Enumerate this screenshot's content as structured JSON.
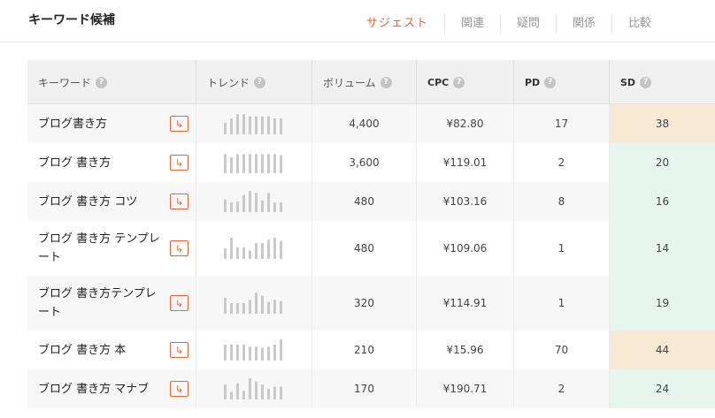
{
  "header": {
    "title": "キーワード候補",
    "tabs": [
      {
        "label": "サジェスト",
        "active": true
      },
      {
        "label": "関連",
        "active": false
      },
      {
        "label": "疑問",
        "active": false
      },
      {
        "label": "関係",
        "active": false
      },
      {
        "label": "比較",
        "active": false
      }
    ]
  },
  "table": {
    "columns": {
      "keyword": "キーワード",
      "trend": "トレンド",
      "volume": "ボリューム",
      "cpc": "CPC",
      "pd": "PD",
      "sd": "SD"
    },
    "help_icon": "?",
    "link_icon": "↳",
    "rows": [
      {
        "keyword": "ブログ書き方",
        "volume": "4,400",
        "cpc": "¥82.80",
        "pd": "17",
        "sd": "38",
        "sd_level": "medium",
        "trend": [
          0.55,
          0.75,
          0.95,
          0.95,
          0.85,
          0.85,
          0.85,
          0.85,
          0.75,
          0.75
        ]
      },
      {
        "keyword": "ブログ 書き方",
        "volume": "3,600",
        "cpc": "¥119.01",
        "pd": "2",
        "sd": "20",
        "sd_level": "low",
        "trend": [
          0.9,
          0.75,
          0.9,
          0.9,
          0.9,
          0.9,
          0.9,
          0.9,
          0.9,
          0.85
        ]
      },
      {
        "keyword": "ブログ 書き方 コツ",
        "volume": "480",
        "cpc": "¥103.16",
        "pd": "8",
        "sd": "16",
        "sd_level": "low",
        "trend": [
          0.6,
          0.45,
          0.5,
          0.8,
          1.0,
          0.9,
          0.55,
          0.9,
          0.45,
          0.45
        ]
      },
      {
        "keyword": "ブログ 書き方 テンプレート",
        "volume": "480",
        "cpc": "¥109.06",
        "pd": "1",
        "sd": "14",
        "sd_level": "low",
        "trend": [
          0.5,
          1.0,
          0.55,
          0.55,
          0.4,
          0.75,
          0.75,
          0.9,
          1.0,
          0.85
        ]
      },
      {
        "keyword": "ブログ 書き方テンプレート",
        "volume": "320",
        "cpc": "¥114.91",
        "pd": "1",
        "sd": "19",
        "sd_level": "low",
        "trend": [
          0.75,
          0.5,
          0.5,
          0.5,
          0.65,
          1.0,
          0.85,
          0.55,
          0.65,
          0.6
        ]
      },
      {
        "keyword": "ブログ 書き方 本",
        "volume": "210",
        "cpc": "¥15.96",
        "pd": "70",
        "sd": "44",
        "sd_level": "medium",
        "trend": [
          0.75,
          0.75,
          0.75,
          0.75,
          0.65,
          0.65,
          0.6,
          0.65,
          0.75,
          1.0
        ]
      },
      {
        "keyword": "ブログ 書き方 マナブ",
        "volume": "170",
        "cpc": "¥190.71",
        "pd": "2",
        "sd": "24",
        "sd_level": "low",
        "trend": [
          0.7,
          0.35,
          0.75,
          0.4,
          1.0,
          0.85,
          0.7,
          0.5,
          0.6,
          0.6
        ]
      }
    ]
  },
  "colors": {
    "accent": "#e0663d",
    "sd_medium_bg": "#f7ead4",
    "sd_low_bg": "#e6f6ef",
    "trend_bar": "#c9c9c9"
  }
}
